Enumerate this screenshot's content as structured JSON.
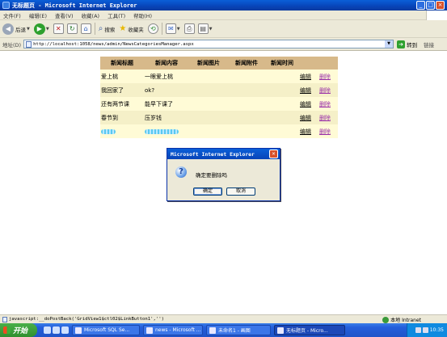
{
  "window": {
    "title": "无标题页 - Microsoft Internet Explorer",
    "buttons": [
      "_",
      "□",
      "×"
    ]
  },
  "menu": [
    "文件(F)",
    "编辑(E)",
    "查看(V)",
    "收藏(A)",
    "工具(T)",
    "帮助(H)"
  ],
  "toolbar": {
    "back": "后退",
    "search": "搜索",
    "favorites": "收藏夹"
  },
  "address": {
    "label": "地址(D)",
    "url": "http://localhost:1058/news/admin/NewsCategoriesManager.aspx",
    "go": "转到",
    "links": "链接"
  },
  "grid": {
    "headers": [
      "新闻标题",
      "新闻内容",
      "新闻图片",
      "新闻附件",
      "新闻时间"
    ],
    "rows": [
      {
        "title": "爱上桃",
        "content": "一眼爱上桃",
        "edit": "编辑",
        "delete": "删除"
      },
      {
        "title": "我回家了",
        "content": "ok?",
        "edit": "编辑",
        "delete": "删除"
      },
      {
        "title": "还有两节课",
        "content": "能早下课了",
        "edit": "编辑",
        "delete": "删除"
      },
      {
        "title": "春节到",
        "content": "压岁钱",
        "edit": "编辑",
        "delete": "删除"
      },
      {
        "title": "",
        "content": "",
        "edit": "编辑",
        "delete": "删除"
      }
    ]
  },
  "dialog": {
    "title": "Microsoft Internet Explorer",
    "message": "确定要删除吗",
    "ok": "确定",
    "cancel": "取消"
  },
  "status": {
    "text": "javascript:__doPostBack('GridView1$ctl02$LinkButton1','')",
    "zone": "本地 Intranet"
  },
  "taskbar": {
    "start": "开始",
    "tasks": [
      {
        "label": "Microsoft SQL Se...",
        "active": false
      },
      {
        "label": "news - Microsoft ...",
        "active": false
      },
      {
        "label": "未命名1 - 画图",
        "active": false
      },
      {
        "label": "无标题页 - Micro...",
        "active": true
      }
    ],
    "clock": "10:35"
  },
  "colors": {
    "header_bg": "#d7b98a",
    "row_odd": "#fffbd6",
    "row_even": "#f5f0c8",
    "titlebar": "#0a5fd8",
    "delete_link": "#9a2fa8"
  }
}
